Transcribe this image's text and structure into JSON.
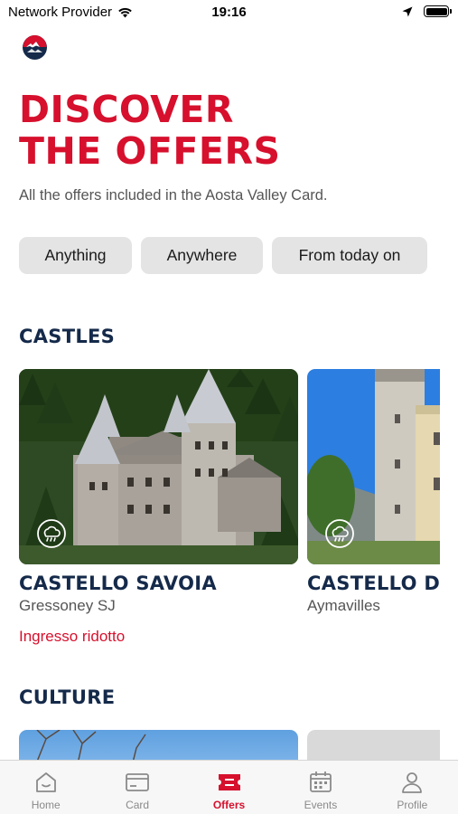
{
  "status_bar": {
    "carrier": "Network Provider",
    "time": "19:16"
  },
  "hero": {
    "title_line1": "DISCOVER",
    "title_line2": "THE OFFERS",
    "subtitle": "All the offers included in the Aosta Valley Card."
  },
  "filters": [
    {
      "label": "Anything"
    },
    {
      "label": "Anywhere"
    },
    {
      "label": "From today on"
    }
  ],
  "sections": {
    "castles": {
      "title": "CASTLES",
      "cards": [
        {
          "title": "CASTELLO SAVOIA",
          "location": "Gressoney SJ",
          "tag": "Ingresso ridotto",
          "icon": "rain-cloud-icon"
        },
        {
          "title": "CASTELLO DI AYMAVILLES",
          "location": "Aymavilles",
          "tag": "",
          "icon": "rain-cloud-icon"
        }
      ]
    },
    "culture": {
      "title": "CULTURE"
    }
  },
  "tab_bar": {
    "items": [
      {
        "label": "Home",
        "icon": "home-icon"
      },
      {
        "label": "Card",
        "icon": "card-icon"
      },
      {
        "label": "Offers",
        "icon": "ticket-icon",
        "active": true
      },
      {
        "label": "Events",
        "icon": "calendar-icon"
      },
      {
        "label": "Profile",
        "icon": "person-icon"
      }
    ]
  },
  "colors": {
    "accent": "#d6102d",
    "navy": "#152a4a",
    "chip_bg": "#e4e4e4",
    "tab_inactive": "#8a8a8a"
  }
}
